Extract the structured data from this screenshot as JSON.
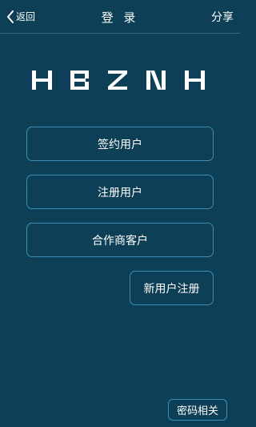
{
  "nav": {
    "back_label": "返回",
    "title": "登 录",
    "share_label": "分享"
  },
  "logo": {
    "text": "HBZNH"
  },
  "buttons": {
    "contract_user": "签约用户",
    "registered_user": "注册用户",
    "partner_customer": "合作商客户",
    "new_user_register": "新用户注册",
    "password_related": "密码相关"
  },
  "colors": {
    "background": "#0d3f56",
    "button_border": "#3d8fb3",
    "text": "#ffffff"
  }
}
